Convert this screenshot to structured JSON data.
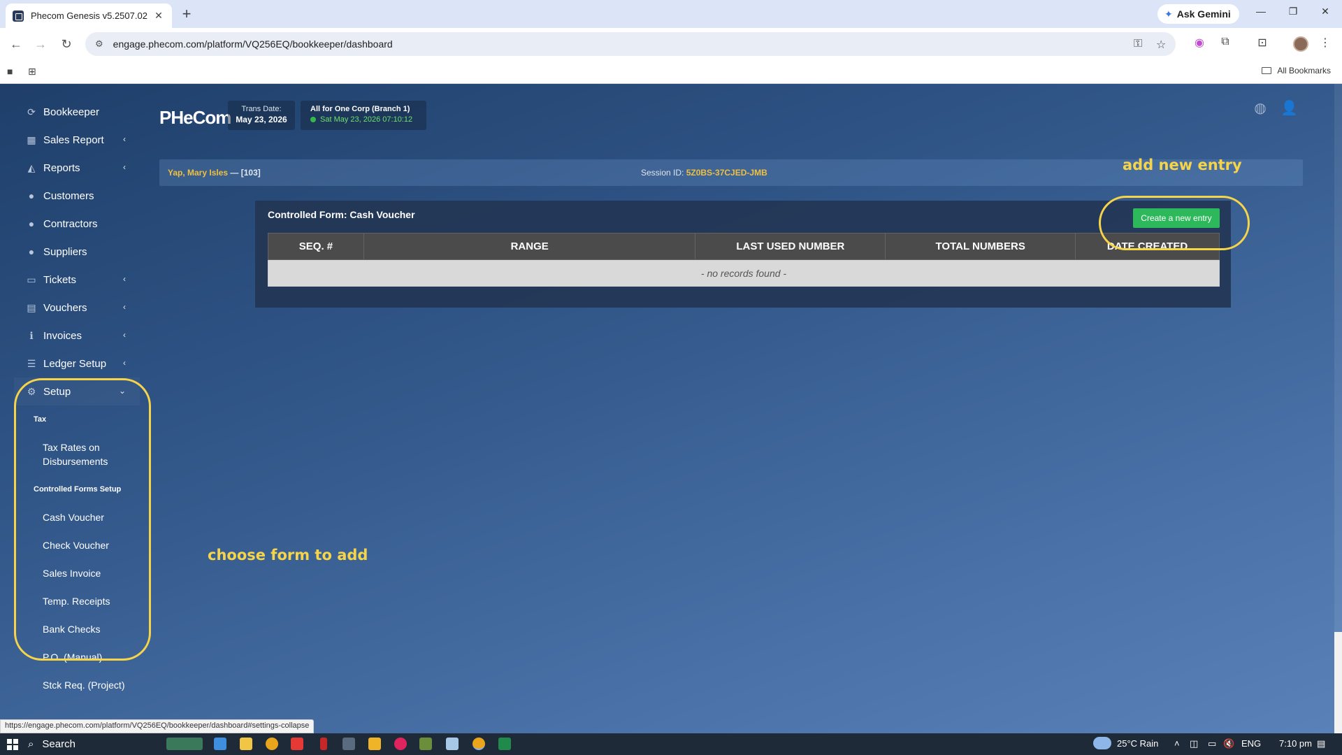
{
  "browser": {
    "tab_title": "Phecom Genesis v5.2507.02",
    "tab_close": "✕",
    "new_tab": "+",
    "ask_gemini": "Ask Gemini",
    "url": "engage.phecom.com/platform/VQ256EQ/bookkeeper/dashboard",
    "all_bookmarks": "All Bookmarks",
    "status_url": "https://engage.phecom.com/platform/VQ256EQ/bookkeeper/dashboard#settings-collapse"
  },
  "sidebar": {
    "items": [
      {
        "label": "Bookkeeper",
        "icon": "refresh-icon",
        "glyph": "⟳",
        "has_chevron": false
      },
      {
        "label": "Sales Report",
        "icon": "table-icon",
        "glyph": "▦",
        "has_chevron": true
      },
      {
        "label": "Reports",
        "icon": "area-chart-icon",
        "glyph": "◭",
        "has_chevron": true
      },
      {
        "label": "Customers",
        "icon": "users-icon",
        "glyph": "●",
        "has_chevron": false
      },
      {
        "label": "Contractors",
        "icon": "users-icon",
        "glyph": "●",
        "has_chevron": false
      },
      {
        "label": "Suppliers",
        "icon": "users-icon",
        "glyph": "●",
        "has_chevron": false
      },
      {
        "label": "Tickets",
        "icon": "ticket-icon",
        "glyph": "▭",
        "has_chevron": true
      },
      {
        "label": "Vouchers",
        "icon": "file-icon",
        "glyph": "▤",
        "has_chevron": true
      },
      {
        "label": "Invoices",
        "icon": "info-icon",
        "glyph": "ℹ",
        "has_chevron": true
      },
      {
        "label": "Ledger Setup",
        "icon": "list-icon",
        "glyph": "☰",
        "has_chevron": true
      },
      {
        "label": "Setup",
        "icon": "cogs-icon",
        "glyph": "⚙",
        "has_chevron": true
      }
    ],
    "chevron_left": "‹",
    "chevron_down": "⌄",
    "setup_sub": {
      "tax_header": "Tax",
      "tax_rates": "Tax Rates on Disbursements",
      "forms_header": "Controlled Forms Setup",
      "forms": [
        "Cash Voucher",
        "Check Voucher",
        "Sales Invoice",
        "Temp. Receipts",
        "Bank Checks",
        "P.O. (Manual)",
        "Stck Req. (Project)"
      ]
    }
  },
  "header": {
    "logo_main": "PHeCom",
    "trans_date_label": "Trans Date:",
    "trans_date_value": "May 23, 2026",
    "corp_name": "All for One Corp (Branch 1)",
    "corp_time": "Sat May 23, 2026 07:10:12"
  },
  "session": {
    "user_name": "Yap, Mary Isles",
    "user_sep": " — ",
    "user_id": "[103]",
    "session_label": "Session ID: ",
    "session_id": "5Z0BS-37CJED-JMB"
  },
  "panel": {
    "title": "Controlled Form: Cash Voucher",
    "create_button": "Create a new entry",
    "columns": [
      "SEQ. #",
      "RANGE",
      "LAST USED NUMBER",
      "TOTAL NUMBERS",
      "DATE CREATED"
    ],
    "empty_message": "- no records found -"
  },
  "annotations": {
    "add_new_entry": "add new entry",
    "choose_form": "choose form to add",
    "color": "#f6d44a"
  },
  "taskbar": {
    "search": "Search",
    "weather": "25°C  Rain",
    "lang": "ENG",
    "time": "7:10 pm"
  }
}
